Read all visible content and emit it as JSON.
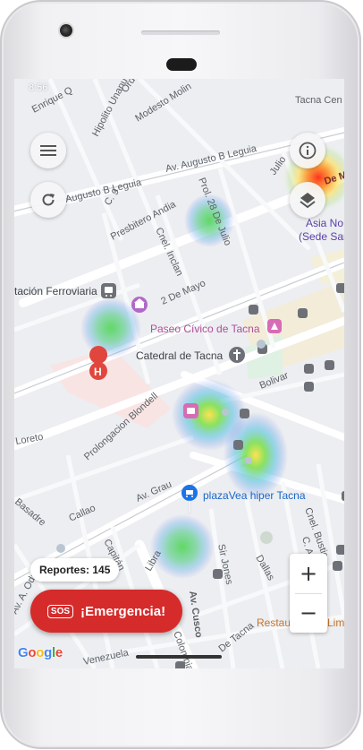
{
  "status": {
    "time": "8:56"
  },
  "map": {
    "streets": {
      "enrique_quijano": "Enrique Q",
      "hipolito_unanue": "Hipolito Unanue",
      "ordenanza": "Ord",
      "modesto_molina": "Modesto Molin",
      "tacna_centro": "Tacna Cen",
      "augusto_b_leguia_main": "Av. Augusto B Leguia",
      "augusto_b_leguia_west": "Augusto B Leguia",
      "calle_9": "C. 9",
      "presbitero_andia": "Presbitero Andia",
      "prol_28_de_julio": "Prol. 28 De Julio",
      "julio": "Julio",
      "de_m": "De M",
      "cnel_inclan": "Cnel. Inclan",
      "dos_de_mayo": "2 De Mayo",
      "bolivar": "Bolivar",
      "loreto": "Loreto",
      "prolongacion_blondell": "Prolongacion Blondell",
      "av_grau": "Av. Grau",
      "callao": "Callao",
      "basadre": "Basadre",
      "capitan": "Capitán",
      "libra": "Libra",
      "av_cusco": "Av. Cusco",
      "sir_jones": "Sir Jones",
      "dallas": "Dallas",
      "cnel_bustios": "Cnel. Bustio",
      "carlos": "C. A",
      "venezuela": "Venezuela",
      "de_tacna": "De Tacna",
      "colombia": "Colombia",
      "av_a_odria": "Av. A. Odr"
    },
    "places": {
      "estacion_ferroviaria": "tación Ferroviaria",
      "paseo_civico": "Paseo Cívico de Tacna",
      "catedral": "Catedral de Tacna",
      "plaza_vea": "plazaVea hiper Tacna",
      "asia_nor": "Asia No",
      "sede_sar": "(Sede Sar",
      "restaurant": "Restau",
      "restaurant_tail": "Lim"
    }
  },
  "controls": {
    "menu_icon": "menu-icon",
    "refresh_icon": "refresh-icon",
    "info_icon": "info-icon",
    "layers_icon": "layers-icon",
    "zoom_in": "+",
    "zoom_out": "−"
  },
  "reports": {
    "label": "Reportes: 145"
  },
  "emergency": {
    "badge": "SOS",
    "label": "¡Emergencia!"
  },
  "google": {
    "letters": [
      "G",
      "o",
      "o",
      "g",
      "l",
      "e"
    ]
  },
  "colors": {
    "sos_red": "#d62b2b",
    "hospital_red": "#e0463d",
    "transit_gray": "#6d7177",
    "landmark_pink": "#d86bb6",
    "shopping_blue": "#1a73e8",
    "poi_violet": "#b268c8",
    "heat_green": "#4fd36a",
    "heat_red": "#ff3b1f"
  }
}
